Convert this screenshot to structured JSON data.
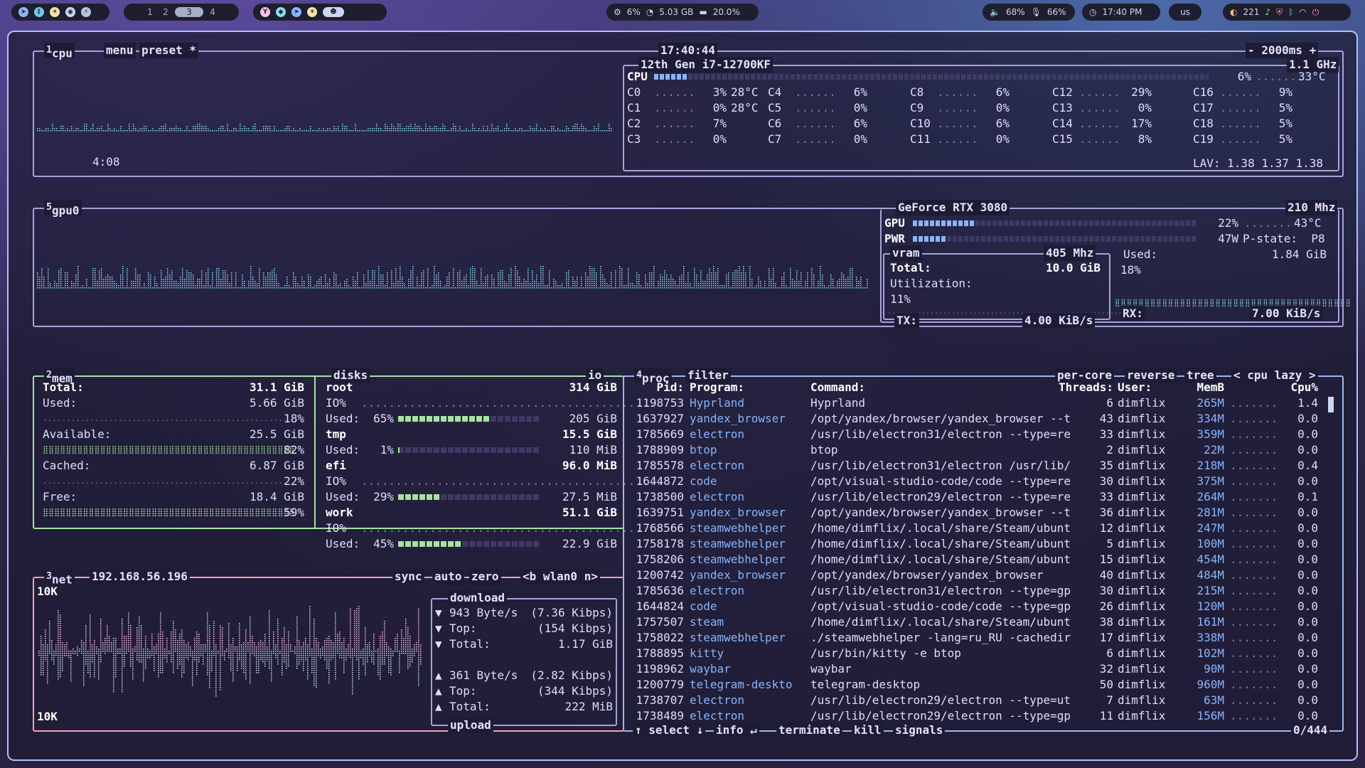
{
  "topbar": {
    "workspaces": [
      "1",
      "2",
      "3",
      "4"
    ],
    "active_workspace": "3",
    "stats": {
      "cpu": "6%",
      "mem": "5.03 GB",
      "disk": "20.0%"
    },
    "volume": "68%",
    "mic": "66%",
    "clock": "17:40 PM",
    "layout": "us",
    "count": "221"
  },
  "cpu": {
    "num": "1",
    "title": "cpu",
    "menu": "menu",
    "preset": "preset *",
    "clock": "17:40:44",
    "interval": "- 2000ms +",
    "uptime": "4:08",
    "model": "12th Gen i7-12700KF",
    "freq": "1.1 GHz",
    "total_label": "CPU",
    "total_pct": "6%",
    "total_temp": "33°C",
    "lav": "LAV: 1.38 1.37 1.38",
    "cores": [
      {
        "name": "C0",
        "pct": "3%",
        "temp": "28°C"
      },
      {
        "name": "C1",
        "pct": "0%",
        "temp": "28°C"
      },
      {
        "name": "C2",
        "pct": "7%",
        "temp": ""
      },
      {
        "name": "C3",
        "pct": "0%",
        "temp": ""
      },
      {
        "name": "C4",
        "pct": "6%",
        "temp": ""
      },
      {
        "name": "C5",
        "pct": "0%",
        "temp": ""
      },
      {
        "name": "C6",
        "pct": "6%",
        "temp": ""
      },
      {
        "name": "C7",
        "pct": "0%",
        "temp": ""
      },
      {
        "name": "C8",
        "pct": "6%",
        "temp": ""
      },
      {
        "name": "C9",
        "pct": "0%",
        "temp": ""
      },
      {
        "name": "C10",
        "pct": "6%",
        "temp": ""
      },
      {
        "name": "C11",
        "pct": "0%",
        "temp": ""
      },
      {
        "name": "C12",
        "pct": "29%",
        "temp": ""
      },
      {
        "name": "C13",
        "pct": "0%",
        "temp": ""
      },
      {
        "name": "C14",
        "pct": "17%",
        "temp": ""
      },
      {
        "name": "C15",
        "pct": "8%",
        "temp": ""
      },
      {
        "name": "C16",
        "pct": "9%",
        "temp": ""
      },
      {
        "name": "C17",
        "pct": "5%",
        "temp": ""
      },
      {
        "name": "C18",
        "pct": "5%",
        "temp": ""
      },
      {
        "name": "C19",
        "pct": "5%",
        "temp": ""
      }
    ]
  },
  "gpu": {
    "num": "5",
    "title": "gpu0",
    "model": "GeForce RTX 3080",
    "clock": "210 Mhz",
    "gpu_label": "GPU",
    "gpu_pct": "22%",
    "gpu_temp": "43°C",
    "pwr_label": "PWR",
    "pwr_val": "47W",
    "pstate": "P-state:  P8",
    "vram_label": "vram",
    "vram_clock": "405 Mhz",
    "total_label": "Total:",
    "total_val": "10.0 GiB",
    "util_label": "Utilization:",
    "util_val": "11%",
    "used_label": "Used:",
    "used_val": "1.84 GiB",
    "used_pct": "18%",
    "tx_label": "TX:",
    "tx_val": "4.00 KiB/s",
    "rx_label": "RX:",
    "rx_val": "7.00 KiB/s"
  },
  "mem": {
    "num": "2",
    "title": "mem",
    "total_label": "Total:",
    "total_val": "31.1 GiB",
    "rows": [
      {
        "label": "Used:",
        "val": "5.66 GiB",
        "pct": "18%"
      },
      {
        "label": "Available:",
        "val": "25.5 GiB",
        "pct": "82%"
      },
      {
        "label": "Cached:",
        "val": "6.87 GiB",
        "pct": "22%"
      },
      {
        "label": "Free:",
        "val": "18.4 GiB",
        "pct": "59%"
      }
    ]
  },
  "disks": {
    "title": "disks",
    "io": "io",
    "list": [
      {
        "name": "root",
        "size": "314 GiB",
        "io": "IO%",
        "used_label": "Used:",
        "used_pct": "65%",
        "used_fraction": 0.65,
        "used_val": "205 GiB"
      },
      {
        "name": "tmp",
        "size": "15.5 GiB",
        "io": "",
        "used_label": "Used:",
        "used_pct": "1%",
        "used_fraction": 0.01,
        "used_val": "110 MiB"
      },
      {
        "name": "efi",
        "size": "96.0 MiB",
        "io": "IO%",
        "used_label": "Used:",
        "used_pct": "29%",
        "used_fraction": 0.29,
        "used_val": "27.5 MiB"
      },
      {
        "name": "work",
        "size": "51.1 GiB",
        "io": "IO%",
        "used_label": "Used:",
        "used_pct": "45%",
        "used_fraction": 0.45,
        "used_val": "22.9 GiB"
      }
    ]
  },
  "net": {
    "num": "3",
    "title": "net",
    "ip": "192.168.56.196",
    "sync": "sync",
    "auto": "auto",
    "zero": "zero",
    "iface": "<b wlan0 n>",
    "scale_top": "10K",
    "scale_bottom": "10K",
    "download_label": "download",
    "upload_label": "upload",
    "download": [
      {
        "arrow": "▼",
        "label": "943 Byte/s",
        "val": "(7.36 Kibps)"
      },
      {
        "arrow": "▼",
        "label": "Top:",
        "val": "(154 Kibps)"
      },
      {
        "arrow": "▼",
        "label": "Total:",
        "val": "1.17 GiB"
      }
    ],
    "upload": [
      {
        "arrow": "▲",
        "label": "361 Byte/s",
        "val": "(2.82 Kibps)"
      },
      {
        "arrow": "▲",
        "label": "Top:",
        "val": "(344 Kibps)"
      },
      {
        "arrow": "▲",
        "label": "Total:",
        "val": "222 MiB"
      }
    ]
  },
  "proc": {
    "num": "4",
    "title": "proc",
    "filter": "filter",
    "per_core": "per-core",
    "reverse": "reverse",
    "tree": "tree",
    "sort": "< cpu lazy >",
    "headers": {
      "pid": "Pid:",
      "program": "Program:",
      "command": "Command:",
      "threads": "Threads:",
      "user": "User:",
      "mem": "MemB",
      "cpu": "Cpu%"
    },
    "rows": [
      {
        "pid": "1198753",
        "program": "Hyprland",
        "command": "Hyprland",
        "threads": "6",
        "user": "dimflix",
        "mem": "265M",
        "cpu": "1.4"
      },
      {
        "pid": "1637927",
        "program": "yandex_browser",
        "command": "/opt/yandex/browser/yandex_browser --t",
        "threads": "43",
        "user": "dimflix",
        "mem": "334M",
        "cpu": "0.0"
      },
      {
        "pid": "1785669",
        "program": "electron",
        "command": "/usr/lib/electron31/electron --type=re",
        "threads": "33",
        "user": "dimflix",
        "mem": "359M",
        "cpu": "0.0"
      },
      {
        "pid": "1788909",
        "program": "btop",
        "command": "btop",
        "threads": "2",
        "user": "dimflix",
        "mem": "22M",
        "cpu": "0.0"
      },
      {
        "pid": "1785578",
        "program": "electron",
        "command": "/usr/lib/electron31/electron /usr/lib/",
        "threads": "35",
        "user": "dimflix",
        "mem": "218M",
        "cpu": "0.4"
      },
      {
        "pid": "1644872",
        "program": "code",
        "command": "/opt/visual-studio-code/code --type=re",
        "threads": "30",
        "user": "dimflix",
        "mem": "375M",
        "cpu": "0.0"
      },
      {
        "pid": "1738500",
        "program": "electron",
        "command": "/usr/lib/electron29/electron --type=re",
        "threads": "33",
        "user": "dimflix",
        "mem": "264M",
        "cpu": "0.1"
      },
      {
        "pid": "1639751",
        "program": "yandex_browser",
        "command": "/opt/yandex/browser/yandex_browser --t",
        "threads": "36",
        "user": "dimflix",
        "mem": "281M",
        "cpu": "0.0"
      },
      {
        "pid": "1768566",
        "program": "steamwebhelper",
        "command": "/home/dimflix/.local/share/Steam/ubunt",
        "threads": "12",
        "user": "dimflix",
        "mem": "247M",
        "cpu": "0.0"
      },
      {
        "pid": "1758178",
        "program": "steamwebhelper",
        "command": "/home/dimflix/.local/share/Steam/ubunt",
        "threads": "5",
        "user": "dimflix",
        "mem": "100M",
        "cpu": "0.0"
      },
      {
        "pid": "1758206",
        "program": "steamwebhelper",
        "command": "/home/dimflix/.local/share/Steam/ubunt",
        "threads": "15",
        "user": "dimflix",
        "mem": "454M",
        "cpu": "0.0"
      },
      {
        "pid": "1200742",
        "program": "yandex_browser",
        "command": "/opt/yandex/browser/yandex_browser",
        "threads": "40",
        "user": "dimflix",
        "mem": "484M",
        "cpu": "0.0"
      },
      {
        "pid": "1785636",
        "program": "electron",
        "command": "/usr/lib/electron31/electron --type=gp",
        "threads": "30",
        "user": "dimflix",
        "mem": "215M",
        "cpu": "0.0"
      },
      {
        "pid": "1644824",
        "program": "code",
        "command": "/opt/visual-studio-code/code --type=gp",
        "threads": "26",
        "user": "dimflix",
        "mem": "120M",
        "cpu": "0.0"
      },
      {
        "pid": "1757507",
        "program": "steam",
        "command": "/home/dimflix/.local/share/Steam/ubunt",
        "threads": "38",
        "user": "dimflix",
        "mem": "161M",
        "cpu": "0.0"
      },
      {
        "pid": "1758022",
        "program": "steamwebhelper",
        "command": "./steamwebhelper -lang=ru_RU -cachedir",
        "threads": "17",
        "user": "dimflix",
        "mem": "338M",
        "cpu": "0.0"
      },
      {
        "pid": "1788895",
        "program": "kitty",
        "command": "/usr/bin/kitty -e btop",
        "threads": "6",
        "user": "dimflix",
        "mem": "102M",
        "cpu": "0.0"
      },
      {
        "pid": "1198962",
        "program": "waybar",
        "command": "waybar",
        "threads": "32",
        "user": "dimflix",
        "mem": "90M",
        "cpu": "0.0"
      },
      {
        "pid": "1200779",
        "program": "telegram-deskto",
        "command": "telegram-desktop",
        "threads": "50",
        "user": "dimflix",
        "mem": "960M",
        "cpu": "0.0"
      },
      {
        "pid": "1738707",
        "program": "electron",
        "command": "/usr/lib/electron29/electron --type=ut",
        "threads": "7",
        "user": "dimflix",
        "mem": "63M",
        "cpu": "0.0"
      },
      {
        "pid": "1738489",
        "program": "electron",
        "command": "/usr/lib/electron29/electron --type=gp",
        "threads": "11",
        "user": "dimflix",
        "mem": "156M",
        "cpu": "0.0"
      }
    ],
    "footer": {
      "select": "↑ select ↓",
      "info": "info ↵",
      "terminate": "terminate",
      "kill": "kill",
      "signals": "signals",
      "count": "0/444"
    }
  },
  "colors": {
    "accent": "#b4befe",
    "mem_border": "#a6e3a1",
    "net_border": "#f5a0b4",
    "proc_border": "#9fb6f0",
    "graph": "#89dceb"
  }
}
